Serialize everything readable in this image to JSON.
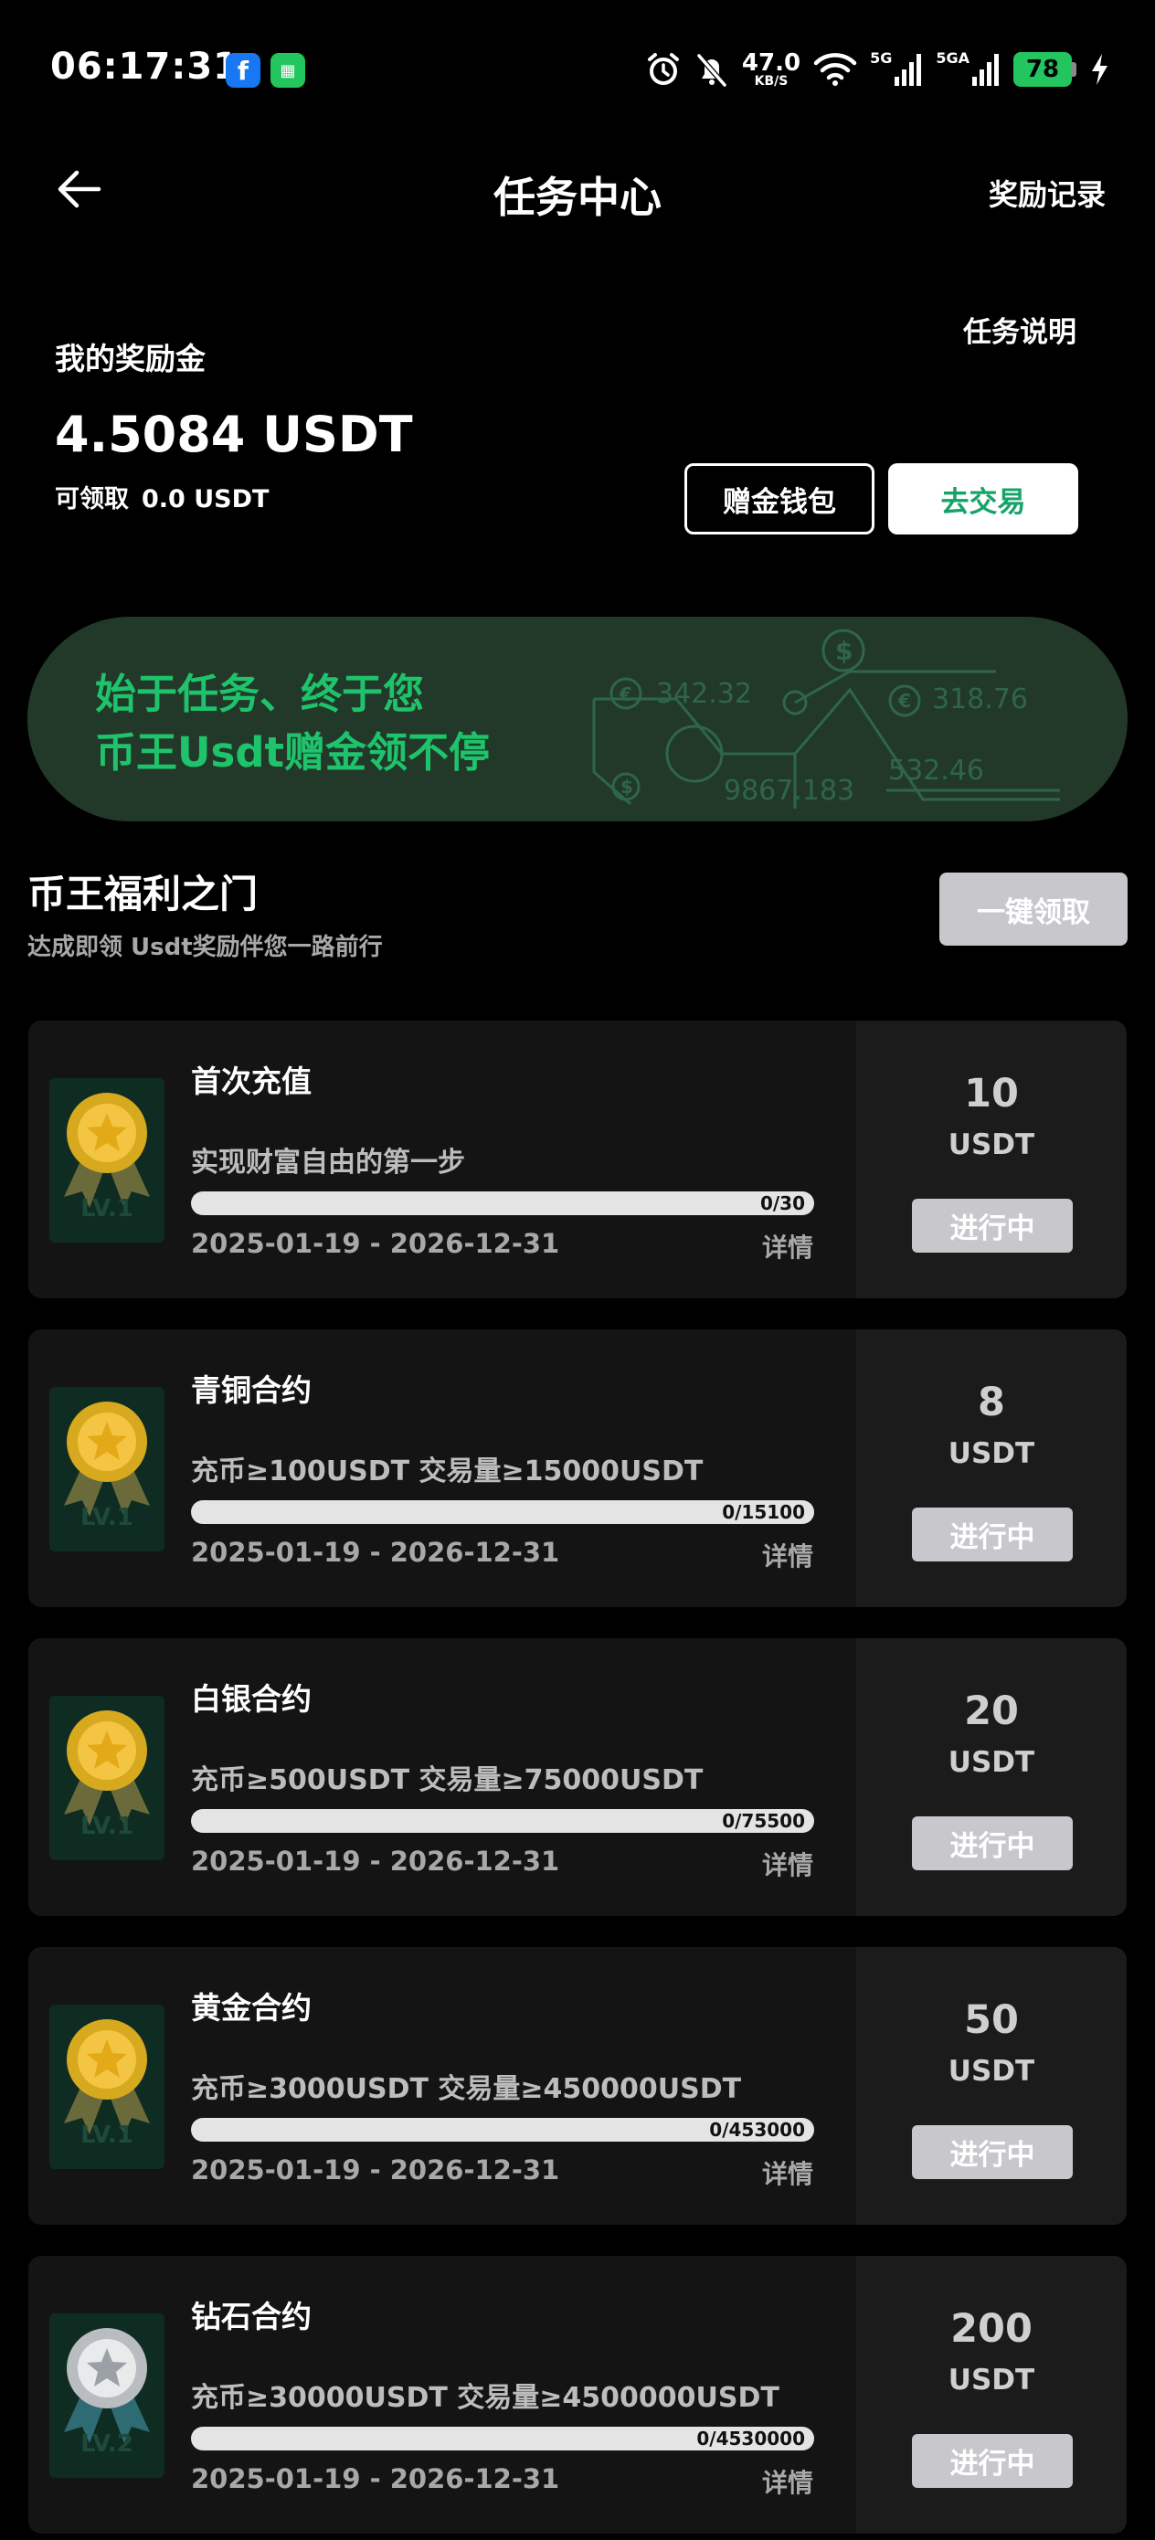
{
  "status_bar": {
    "time": "06:17:31",
    "net_speed": "47.0",
    "net_unit": "KB/S",
    "sig1_label": "5G",
    "sig2_label": "5GA",
    "battery": "78"
  },
  "header": {
    "title": "任务中心",
    "rewards_link": "奖励记录"
  },
  "balance": {
    "task_explain": "任务说明",
    "label": "我的奖励金",
    "value": "4.5084 USDT",
    "claimable_label": "可领取",
    "claimable_value": "0.0 USDT",
    "wallet_button": "赠金钱包",
    "trade_button": "去交易"
  },
  "banner": {
    "line1": "始于任务、终于您",
    "line2": "币王Usdt赠金领不停",
    "deco_values": [
      "342.32",
      "318.76",
      "9867.183",
      "532.46"
    ]
  },
  "section": {
    "title": "币王福利之门",
    "subtitle": "达成即领 Usdt奖励伴您一路前行",
    "claim_all": "一键领取"
  },
  "tasks": [
    {
      "title": "首次充值",
      "desc": "实现财富自由的第一步",
      "progress_text": "0/30",
      "progress": 0,
      "dates": "2025-01-19 - 2026-12-31",
      "detail": "详情",
      "reward": "10",
      "unit": "USDT",
      "status": "进行中",
      "level": "LV.1",
      "medal": "gold"
    },
    {
      "title": "青铜合约",
      "desc": "充币≥100USDT 交易量≥15000USDT",
      "progress_text": "0/15100",
      "progress": 0,
      "dates": "2025-01-19 - 2026-12-31",
      "detail": "详情",
      "reward": "8",
      "unit": "USDT",
      "status": "进行中",
      "level": "LV.1",
      "medal": "gold"
    },
    {
      "title": "白银合约",
      "desc": "充币≥500USDT 交易量≥75000USDT",
      "progress_text": "0/75500",
      "progress": 0,
      "dates": "2025-01-19 - 2026-12-31",
      "detail": "详情",
      "reward": "20",
      "unit": "USDT",
      "status": "进行中",
      "level": "LV.1",
      "medal": "gold"
    },
    {
      "title": "黄金合约",
      "desc": "充币≥3000USDT 交易量≥450000USDT",
      "progress_text": "0/453000",
      "progress": 0,
      "dates": "2025-01-19 - 2026-12-31",
      "detail": "详情",
      "reward": "50",
      "unit": "USDT",
      "status": "进行中",
      "level": "LV.1",
      "medal": "gold"
    },
    {
      "title": "钻石合约",
      "desc": "充币≥30000USDT 交易量≥4500000USDT",
      "progress_text": "0/4530000",
      "progress": 0,
      "dates": "2025-01-19 - 2026-12-31",
      "detail": "详情",
      "reward": "200",
      "unit": "USDT",
      "status": "进行中",
      "level": "LV.2",
      "medal": "silver"
    }
  ],
  "colors": {
    "accent": "#1ec36b",
    "banner_bg": "#22392a",
    "card_bg": "#141414",
    "disabled_button": "#c8c8cc"
  }
}
